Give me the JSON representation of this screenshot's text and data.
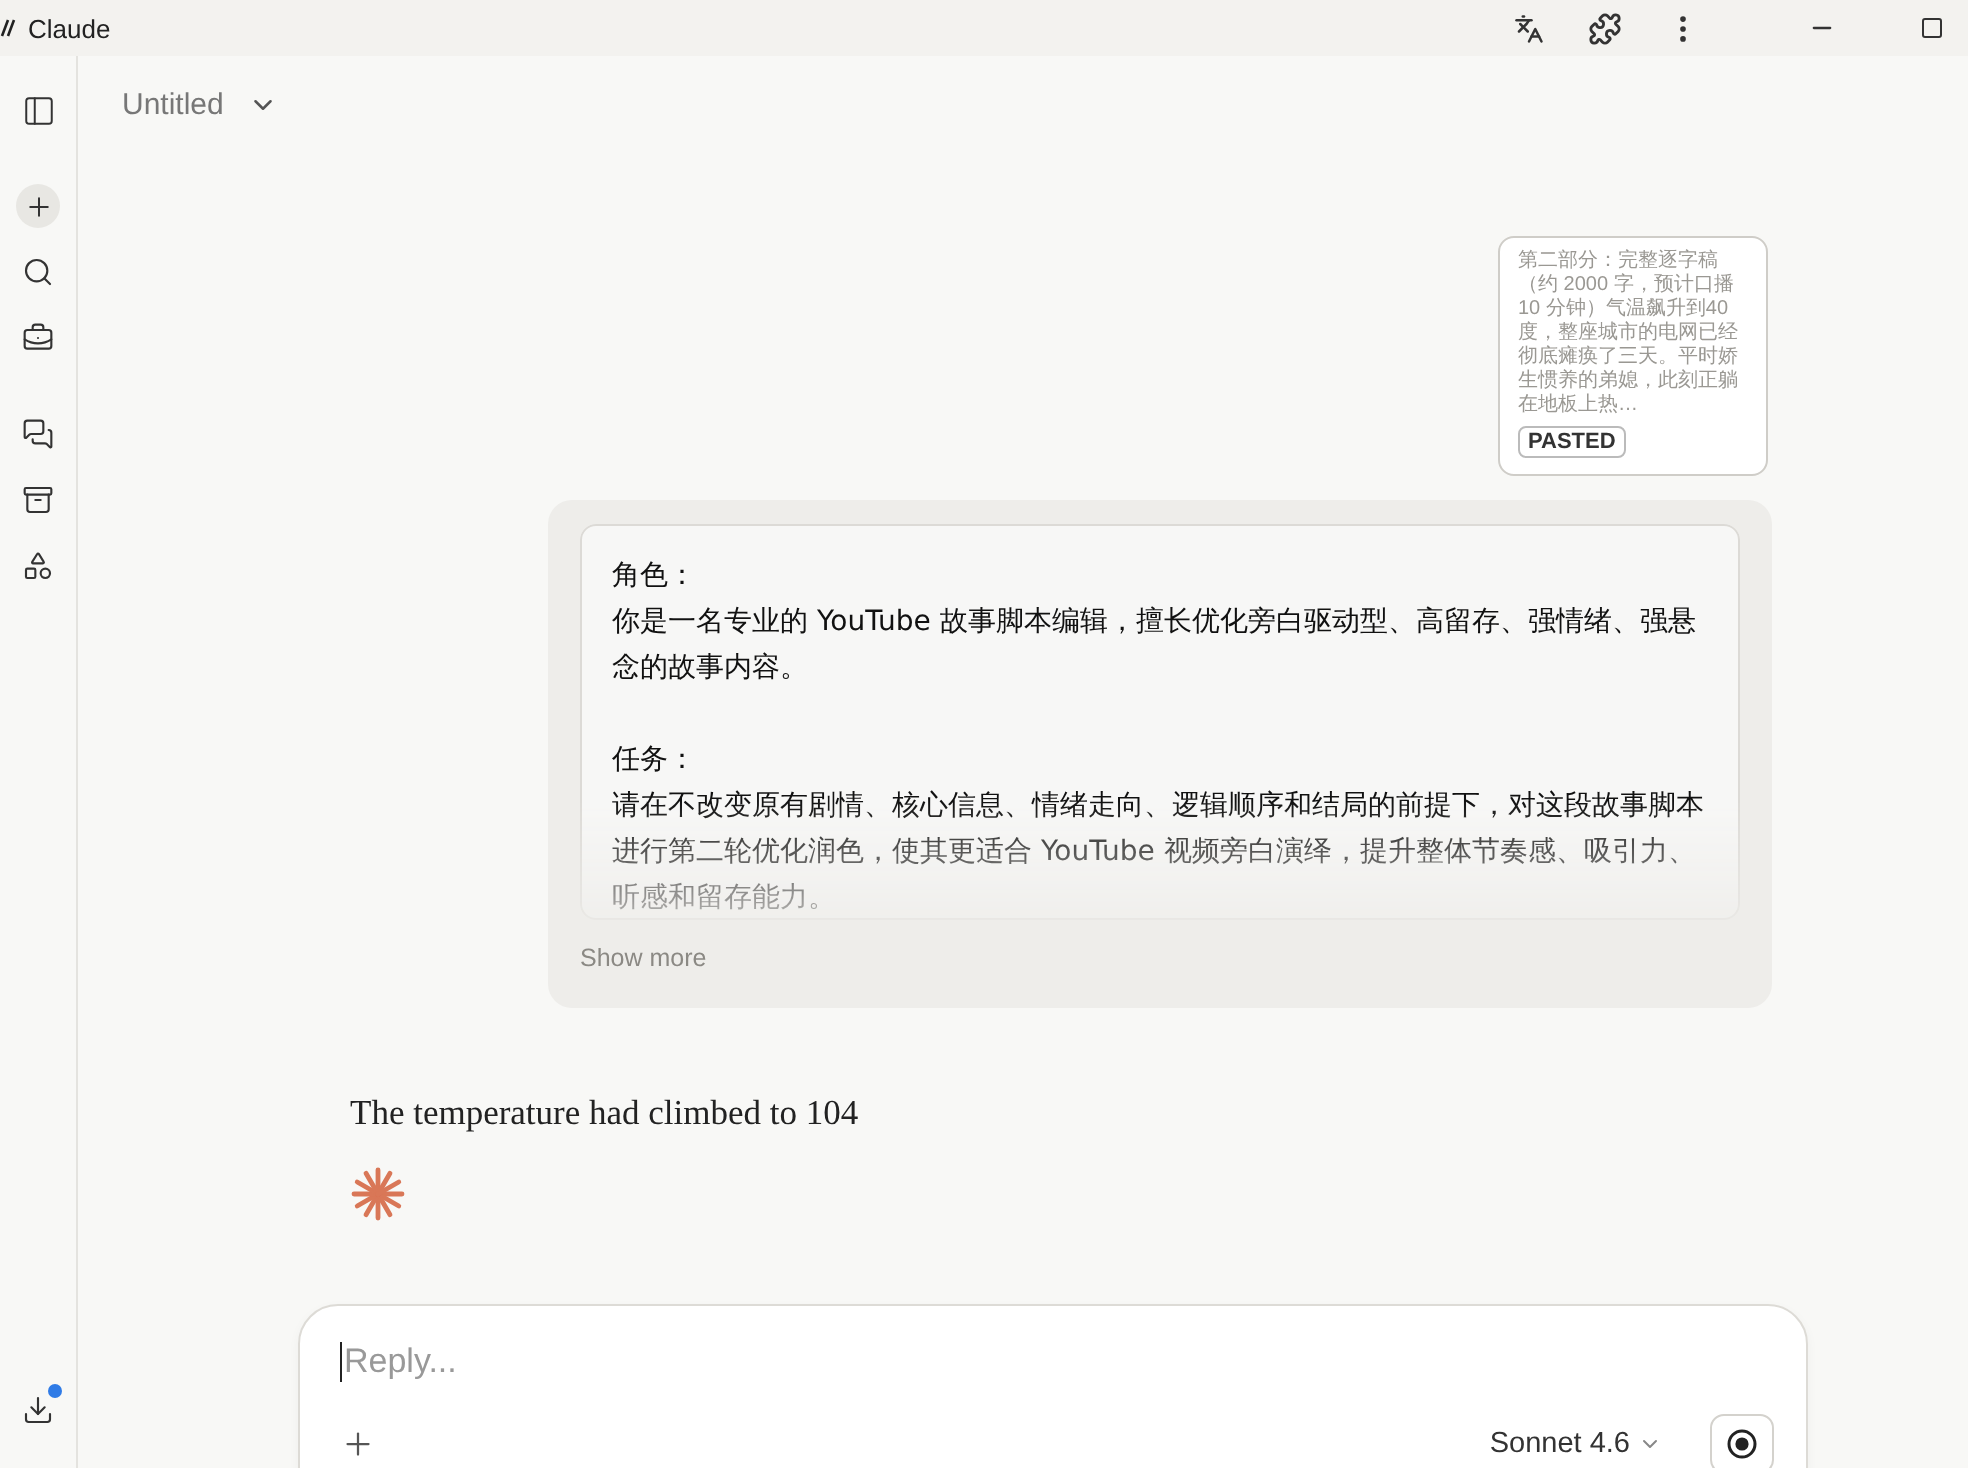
{
  "window": {
    "title": "Claude"
  },
  "header": {
    "title": "Untitled"
  },
  "sidebar": {
    "download_notification": true
  },
  "pasted_card": {
    "preview": "第二部分：完整逐字稿（约 2000 字，预计口播 10 分钟）气温飙升到40度，整座城市的电网已经彻底瘫痪了三天。平时娇生惯养的弟媳，此刻正躺在地板上热…",
    "badge": "PASTED"
  },
  "user_message": {
    "paragraphs": [
      {
        "heading": "角色：",
        "body": "你是一名专业的 YouTube 故事脚本编辑，擅长优化旁白驱动型、高留存、强情绪、强悬念的故事内容。"
      },
      {
        "heading": "任务：",
        "body": "请在不改变原有剧情、核心信息、情绪走向、逻辑顺序和结局的前提下，对这段故事脚本进行第二轮优化润色，使其更适合 YouTube 视频旁白演绎，提升整体节奏感、吸引力、听感和留存能力。"
      }
    ],
    "toggle": "Show more"
  },
  "assistant_message": {
    "text": "The temperature had climbed to 104"
  },
  "composer": {
    "placeholder": "Reply...",
    "model": "Sonnet 4.6"
  }
}
